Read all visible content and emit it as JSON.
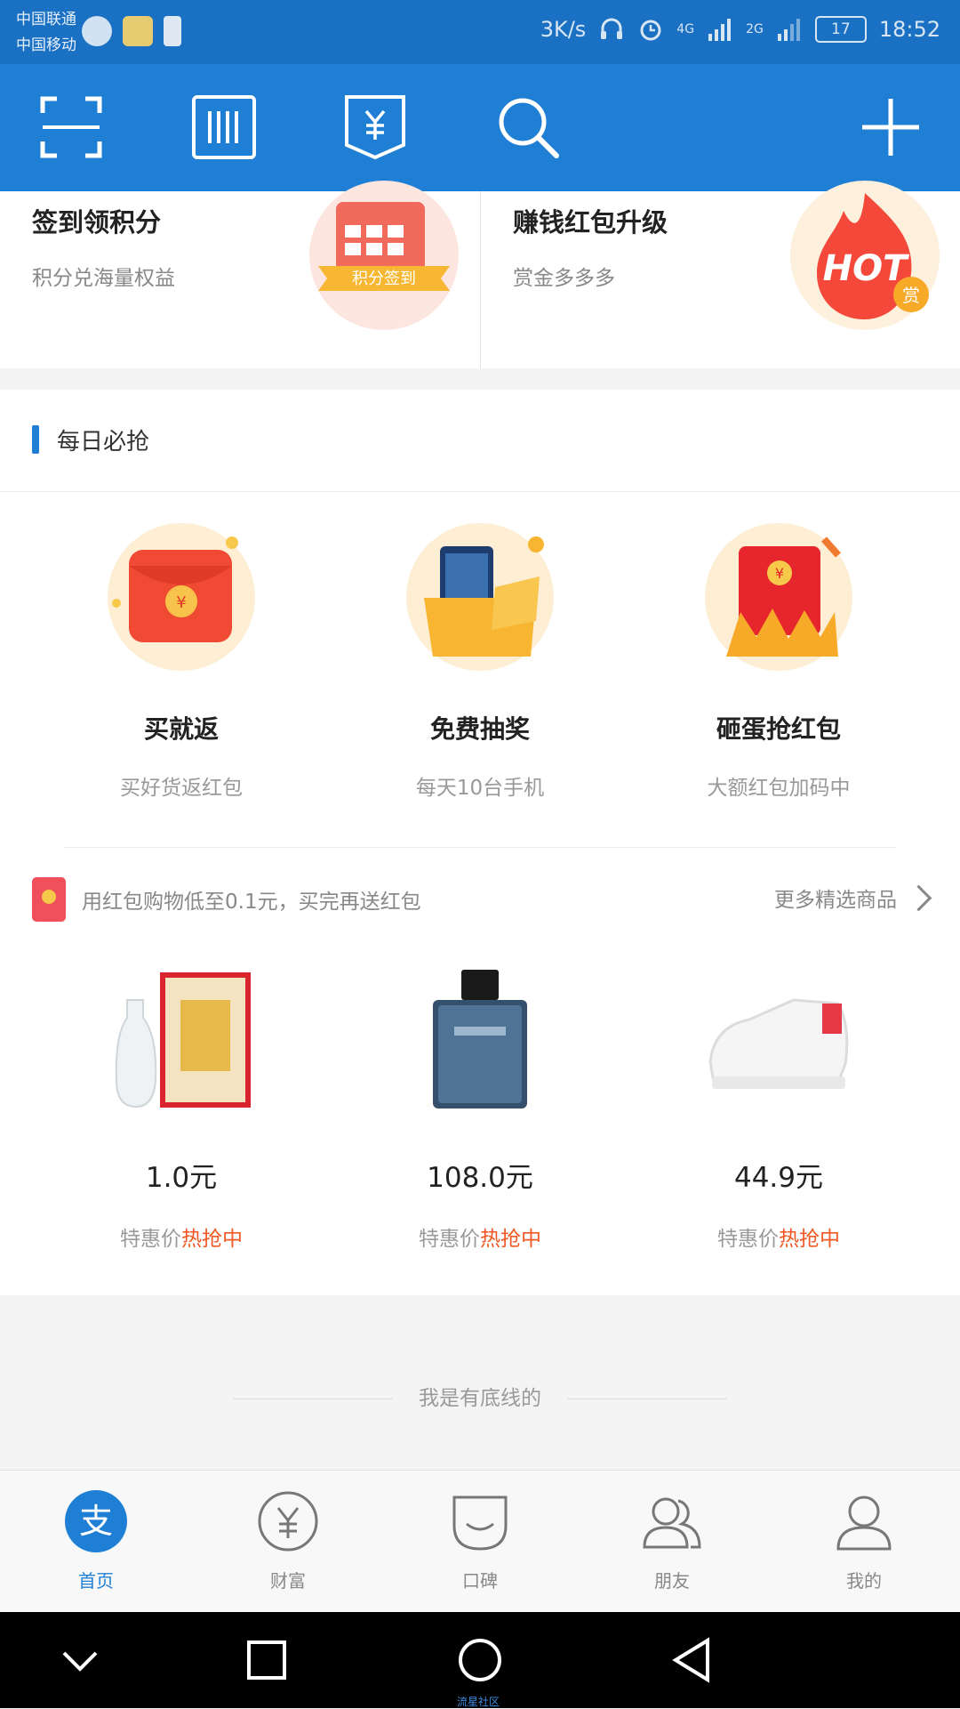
{
  "status_bar": {
    "carrier1": "中国联通",
    "carrier2": "中国移动",
    "speed": "3K/s",
    "net1": "4G",
    "net2": "2G",
    "battery": "17",
    "time": "18:52"
  },
  "toolbar": {
    "icons": [
      "scan-icon",
      "barcode-icon",
      "receipt-yuan-icon",
      "search-icon",
      "plus-icon"
    ]
  },
  "top_cards": [
    {
      "title": "签到领积分",
      "subtitle": "积分兑海量权益",
      "badge": "积分签到"
    },
    {
      "title": "赚钱红包升级",
      "subtitle": "赏金多多多",
      "badge": "HOT",
      "badge2": "赏"
    }
  ],
  "daily": {
    "title": "每日必抢",
    "deals": [
      {
        "title": "买就返",
        "subtitle": "买好货返红包"
      },
      {
        "title": "免费抽奖",
        "subtitle": "每天10台手机"
      },
      {
        "title": "砸蛋抢红包",
        "subtitle": "大额红包加码中"
      }
    ],
    "promo_text": "用红包购物低至0.1元，买完再送红包",
    "more_label": "更多精选商品",
    "products": [
      {
        "price": "1.0元",
        "tag_prefix": "特惠价",
        "tag_hot": "热抢中"
      },
      {
        "price": "108.0元",
        "tag_prefix": "特惠价",
        "tag_hot": "热抢中"
      },
      {
        "price": "44.9元",
        "tag_prefix": "特惠价",
        "tag_hot": "热抢中"
      }
    ]
  },
  "footer_note": "我是有底线的",
  "tabs": [
    {
      "label": "首页",
      "active": true
    },
    {
      "label": "财富",
      "active": false
    },
    {
      "label": "口碑",
      "active": false
    },
    {
      "label": "朋友",
      "active": false
    },
    {
      "label": "我的",
      "active": false
    }
  ],
  "nav_watermark": "流星社区",
  "colors": {
    "primary": "#1f7fd5",
    "hot": "#f15a24",
    "statusbar": "#1a70c2"
  }
}
